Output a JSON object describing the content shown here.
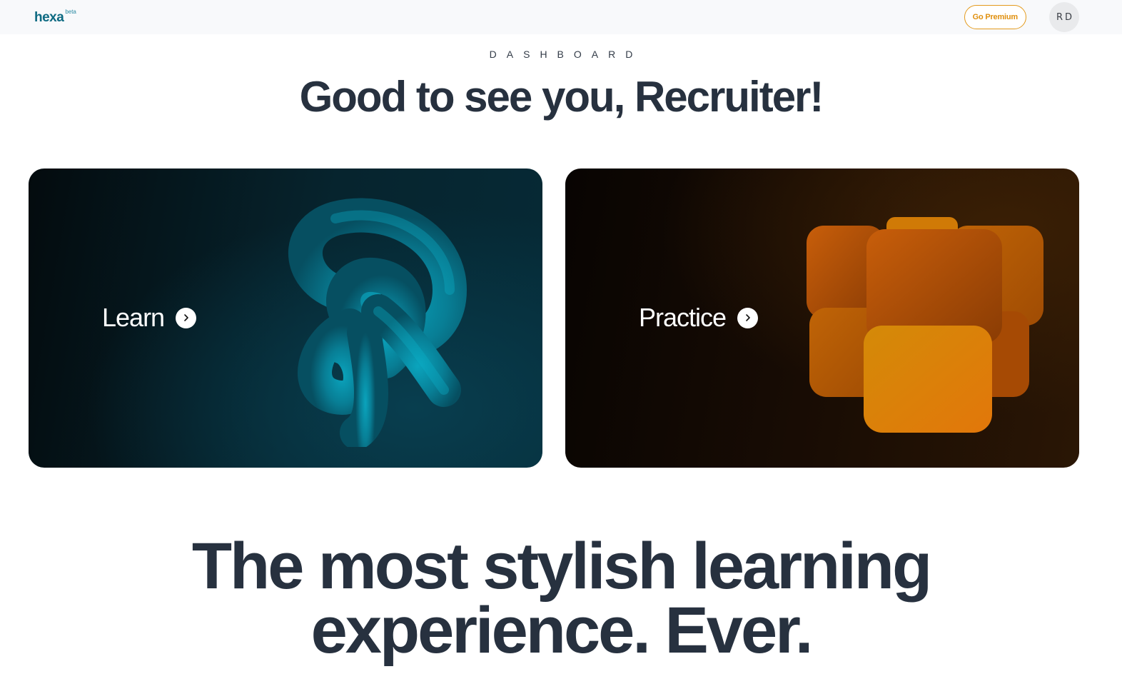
{
  "header": {
    "logo_text": "hexa",
    "logo_badge": "beta",
    "premium_label": "Go Premium",
    "avatar_initials": "RD"
  },
  "hero": {
    "overline": "DASHBOARD",
    "greeting": "Good to see you, Recruiter!"
  },
  "cards": {
    "learn": {
      "label": "Learn",
      "icon": "chevron-right-icon"
    },
    "practice": {
      "label": "Practice",
      "icon": "chevron-right-icon"
    }
  },
  "tagline": {
    "line1": "The most stylish learning",
    "line2": "experience. Ever."
  },
  "colors": {
    "brand": "#0e6a82",
    "premium_accent": "#e39a1c",
    "heading": "#27313f",
    "learn_art": "#0a8aa6",
    "practice_art": "#e0820f"
  }
}
